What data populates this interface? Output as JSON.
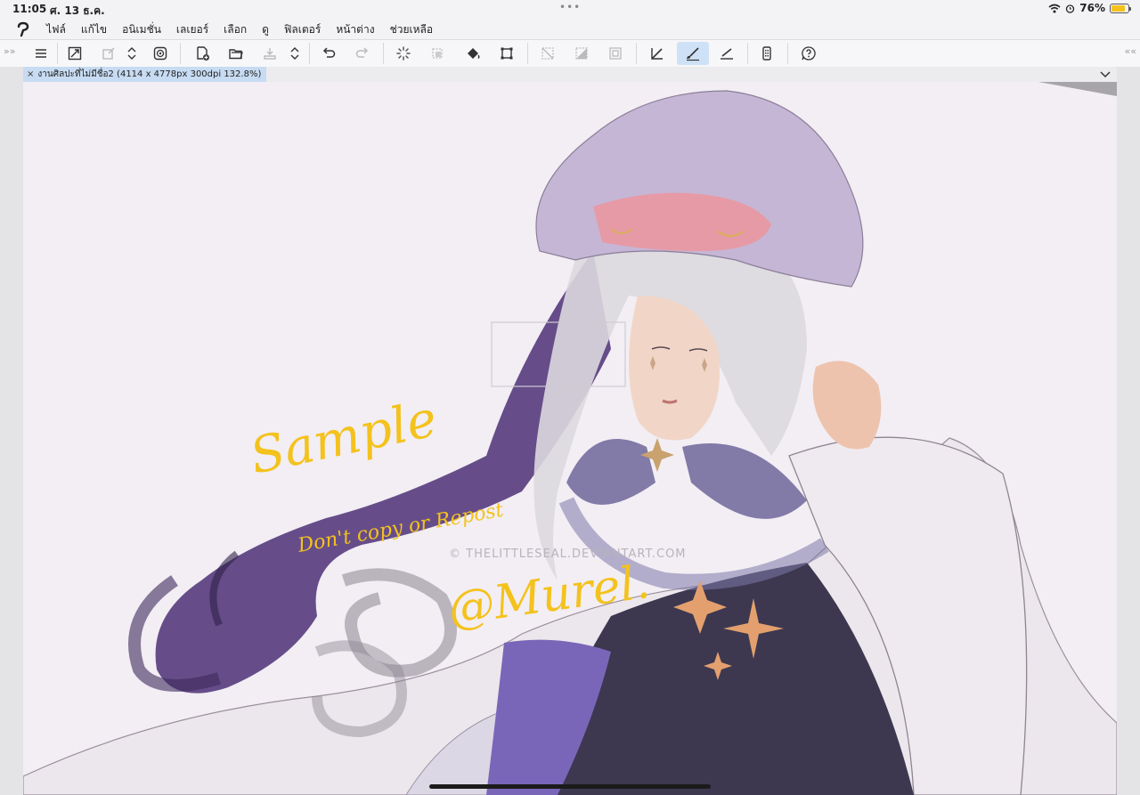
{
  "status_bar": {
    "time": "11:05",
    "date": "ศ. 13 ธ.ค.",
    "dots": "•••",
    "battery_percent": "76%",
    "battery_level": 0.76,
    "battery_color": "#f4c21d"
  },
  "menu": {
    "items": [
      "ไฟล์",
      "แก้ไข",
      "อนิเมชั่น",
      "เลเยอร์",
      "เลือก",
      "ดู",
      "ฟิลเตอร์",
      "หน้าต่าง",
      "ช่วยเหลือ"
    ]
  },
  "toolbar": {
    "left_arrows": "»»",
    "right_arrows": "««",
    "tools": [
      "menu-icon",
      "fit-icon",
      "transform-icon",
      "updown-icon",
      "spiral-icon",
      "new-canvas-icon",
      "open-folder-icon",
      "save-cloud-icon",
      "updown-icon",
      "undo-icon",
      "redo-icon",
      "loading-icon",
      "clear-layer-icon",
      "fill-bucket-icon",
      "crop-icon",
      "deselect-icon",
      "invert-selection-icon",
      "selection-border-icon",
      "ruler-pen-icon",
      "brush-icon",
      "eraser-pen-icon",
      "device-icon",
      "help-icon"
    ],
    "active_tool": "brush-icon",
    "accent_color": "#cfe1f6"
  },
  "document": {
    "tab_label": "งานศิลปะที่ไม่มีชื่อ2 (4114 x 4778px 300dpi 132.8%)",
    "close_symbol": "×"
  },
  "artwork": {
    "watermark_lines": [
      "Sample",
      "Don't copy or Repost",
      "@Murel."
    ],
    "site_watermark": "© THELITTLESEAL.DEVIANTART.COM",
    "ink_color": "#f4c21d",
    "background": "#f2eef4"
  }
}
